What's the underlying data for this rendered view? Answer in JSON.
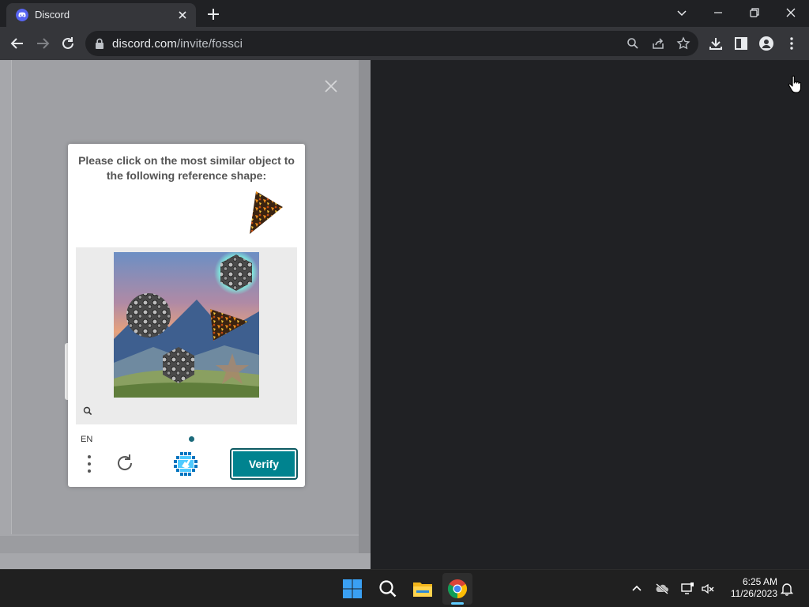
{
  "browser": {
    "tab": {
      "title": "Discord"
    },
    "url": {
      "host": "discord.com",
      "path": "/invite/fossci"
    }
  },
  "captcha": {
    "prompt": "Please click on the most similar object to the following reference shape:",
    "language": "EN",
    "verify_label": "Verify",
    "colors": {
      "accent": "#00838f",
      "progress": "#1b6a7a"
    }
  },
  "taskbar": {
    "time": "6:25 AM",
    "date": "11/26/2023"
  }
}
